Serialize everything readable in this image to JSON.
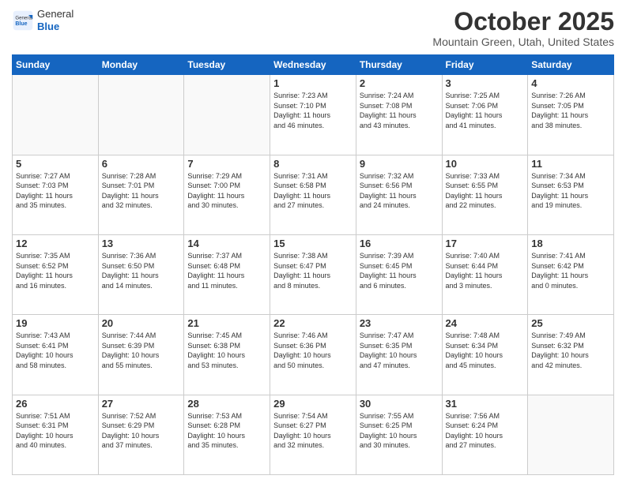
{
  "header": {
    "logo_general": "General",
    "logo_blue": "Blue",
    "month_title": "October 2025",
    "location": "Mountain Green, Utah, United States"
  },
  "weekdays": [
    "Sunday",
    "Monday",
    "Tuesday",
    "Wednesday",
    "Thursday",
    "Friday",
    "Saturday"
  ],
  "weeks": [
    [
      {
        "day": "",
        "info": ""
      },
      {
        "day": "",
        "info": ""
      },
      {
        "day": "",
        "info": ""
      },
      {
        "day": "1",
        "info": "Sunrise: 7:23 AM\nSunset: 7:10 PM\nDaylight: 11 hours\nand 46 minutes."
      },
      {
        "day": "2",
        "info": "Sunrise: 7:24 AM\nSunset: 7:08 PM\nDaylight: 11 hours\nand 43 minutes."
      },
      {
        "day": "3",
        "info": "Sunrise: 7:25 AM\nSunset: 7:06 PM\nDaylight: 11 hours\nand 41 minutes."
      },
      {
        "day": "4",
        "info": "Sunrise: 7:26 AM\nSunset: 7:05 PM\nDaylight: 11 hours\nand 38 minutes."
      }
    ],
    [
      {
        "day": "5",
        "info": "Sunrise: 7:27 AM\nSunset: 7:03 PM\nDaylight: 11 hours\nand 35 minutes."
      },
      {
        "day": "6",
        "info": "Sunrise: 7:28 AM\nSunset: 7:01 PM\nDaylight: 11 hours\nand 32 minutes."
      },
      {
        "day": "7",
        "info": "Sunrise: 7:29 AM\nSunset: 7:00 PM\nDaylight: 11 hours\nand 30 minutes."
      },
      {
        "day": "8",
        "info": "Sunrise: 7:31 AM\nSunset: 6:58 PM\nDaylight: 11 hours\nand 27 minutes."
      },
      {
        "day": "9",
        "info": "Sunrise: 7:32 AM\nSunset: 6:56 PM\nDaylight: 11 hours\nand 24 minutes."
      },
      {
        "day": "10",
        "info": "Sunrise: 7:33 AM\nSunset: 6:55 PM\nDaylight: 11 hours\nand 22 minutes."
      },
      {
        "day": "11",
        "info": "Sunrise: 7:34 AM\nSunset: 6:53 PM\nDaylight: 11 hours\nand 19 minutes."
      }
    ],
    [
      {
        "day": "12",
        "info": "Sunrise: 7:35 AM\nSunset: 6:52 PM\nDaylight: 11 hours\nand 16 minutes."
      },
      {
        "day": "13",
        "info": "Sunrise: 7:36 AM\nSunset: 6:50 PM\nDaylight: 11 hours\nand 14 minutes."
      },
      {
        "day": "14",
        "info": "Sunrise: 7:37 AM\nSunset: 6:48 PM\nDaylight: 11 hours\nand 11 minutes."
      },
      {
        "day": "15",
        "info": "Sunrise: 7:38 AM\nSunset: 6:47 PM\nDaylight: 11 hours\nand 8 minutes."
      },
      {
        "day": "16",
        "info": "Sunrise: 7:39 AM\nSunset: 6:45 PM\nDaylight: 11 hours\nand 6 minutes."
      },
      {
        "day": "17",
        "info": "Sunrise: 7:40 AM\nSunset: 6:44 PM\nDaylight: 11 hours\nand 3 minutes."
      },
      {
        "day": "18",
        "info": "Sunrise: 7:41 AM\nSunset: 6:42 PM\nDaylight: 11 hours\nand 0 minutes."
      }
    ],
    [
      {
        "day": "19",
        "info": "Sunrise: 7:43 AM\nSunset: 6:41 PM\nDaylight: 10 hours\nand 58 minutes."
      },
      {
        "day": "20",
        "info": "Sunrise: 7:44 AM\nSunset: 6:39 PM\nDaylight: 10 hours\nand 55 minutes."
      },
      {
        "day": "21",
        "info": "Sunrise: 7:45 AM\nSunset: 6:38 PM\nDaylight: 10 hours\nand 53 minutes."
      },
      {
        "day": "22",
        "info": "Sunrise: 7:46 AM\nSunset: 6:36 PM\nDaylight: 10 hours\nand 50 minutes."
      },
      {
        "day": "23",
        "info": "Sunrise: 7:47 AM\nSunset: 6:35 PM\nDaylight: 10 hours\nand 47 minutes."
      },
      {
        "day": "24",
        "info": "Sunrise: 7:48 AM\nSunset: 6:34 PM\nDaylight: 10 hours\nand 45 minutes."
      },
      {
        "day": "25",
        "info": "Sunrise: 7:49 AM\nSunset: 6:32 PM\nDaylight: 10 hours\nand 42 minutes."
      }
    ],
    [
      {
        "day": "26",
        "info": "Sunrise: 7:51 AM\nSunset: 6:31 PM\nDaylight: 10 hours\nand 40 minutes."
      },
      {
        "day": "27",
        "info": "Sunrise: 7:52 AM\nSunset: 6:29 PM\nDaylight: 10 hours\nand 37 minutes."
      },
      {
        "day": "28",
        "info": "Sunrise: 7:53 AM\nSunset: 6:28 PM\nDaylight: 10 hours\nand 35 minutes."
      },
      {
        "day": "29",
        "info": "Sunrise: 7:54 AM\nSunset: 6:27 PM\nDaylight: 10 hours\nand 32 minutes."
      },
      {
        "day": "30",
        "info": "Sunrise: 7:55 AM\nSunset: 6:25 PM\nDaylight: 10 hours\nand 30 minutes."
      },
      {
        "day": "31",
        "info": "Sunrise: 7:56 AM\nSunset: 6:24 PM\nDaylight: 10 hours\nand 27 minutes."
      },
      {
        "day": "",
        "info": ""
      }
    ]
  ]
}
